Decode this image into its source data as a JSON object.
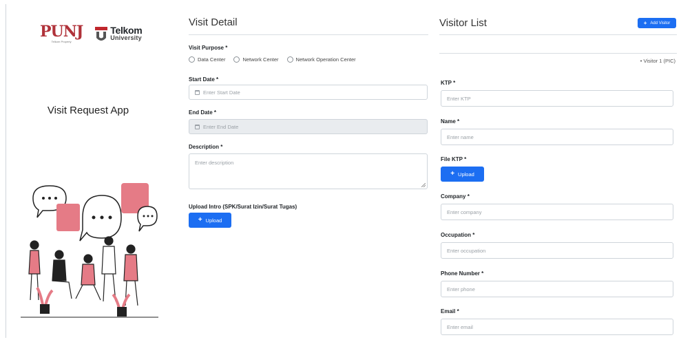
{
  "branding": {
    "puni_mark": "PUNJ",
    "puni_sub": "Telkom Property",
    "telkom_word": "Telkom",
    "telkom_sub": "University",
    "app_title": "Visit Request App"
  },
  "visit_detail": {
    "title": "Visit Detail",
    "purpose_label": "Visit Purpose",
    "purpose_options": [
      "Data Center",
      "Network Center",
      "Network Operation Center"
    ],
    "start_date_label": "Start Date",
    "start_date_placeholder": "Enter Start Date",
    "end_date_label": "End Date",
    "end_date_placeholder": "Enter End Date",
    "description_label": "Description",
    "description_placeholder": "Enter description",
    "upload_label": "Upload Intro (SPK/Surat Izin/Surat Tugas)",
    "upload_button": "Upload"
  },
  "visitor_list": {
    "title": "Visitor List",
    "add_button": "Add Visitor",
    "visitor_tag": "• Visitor 1 (PIC)",
    "ktp_label": "KTP",
    "ktp_placeholder": "Enter KTP",
    "name_label": "Name",
    "name_placeholder": "Enter name",
    "file_ktp_label": "File KTP",
    "file_ktp_button": "Upload",
    "company_label": "Company",
    "company_placeholder": "Enter company",
    "occupation_label": "Occupation",
    "occupation_placeholder": "Enter occupation",
    "phone_label": "Phone Number",
    "phone_placeholder": "Enter phone",
    "email_label": "Email",
    "email_placeholder": "Enter email"
  },
  "required_marker": "*",
  "colors": {
    "primary": "#1c6ef2",
    "brand_red": "#b0323a",
    "illustration_pink": "#e57b86"
  }
}
